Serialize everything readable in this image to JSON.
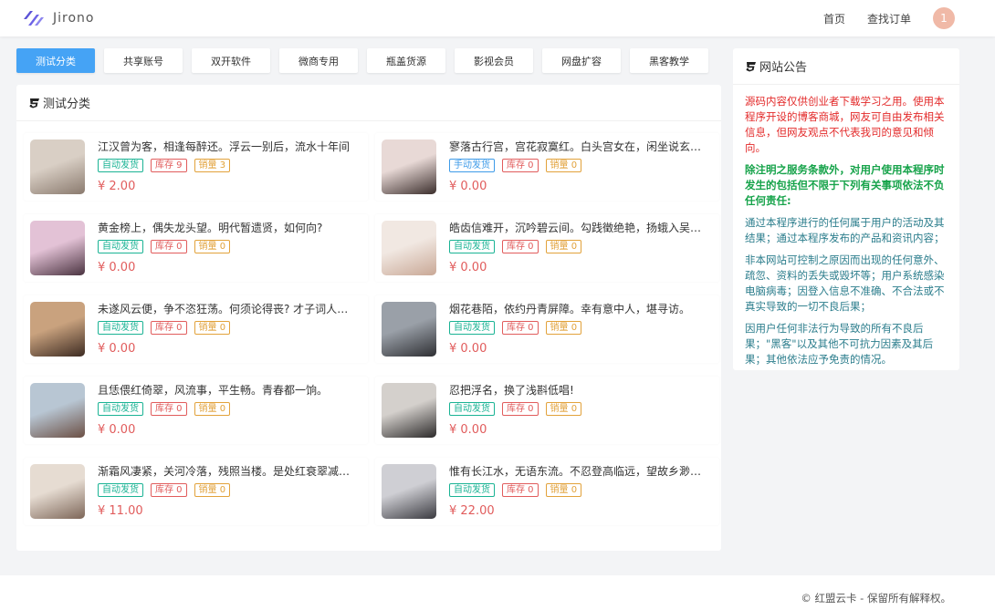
{
  "header": {
    "logo_text": "Jirono",
    "nav": [
      "首页",
      "查找订单"
    ],
    "avatar_text": "1"
  },
  "tabs": [
    "测试分类",
    "共享账号",
    "双开软件",
    "微商专用",
    "瓶盖货源",
    "影视会员",
    "网盘扩容",
    "黑客教学"
  ],
  "category_title": "测试分类",
  "products": [
    {
      "title": "江汉曾为客，相逢每醉还。浮云一别后，流水十年间",
      "delivery": "自动发货",
      "delivery_type": "auto",
      "stock": "库存 9",
      "sales": "销量 3",
      "price": "¥ 2.00",
      "thumb": [
        "#d9cfc5",
        "#8a7a6e"
      ]
    },
    {
      "title": "寥落古行宫，宫花寂寞红。白头宫女在，闲坐说玄宗。",
      "delivery": "手动发货",
      "delivery_type": "manual",
      "stock": "库存 0",
      "sales": "销量 0",
      "price": "¥ 0.00",
      "thumb": [
        "#e8d9d6",
        "#3b2e2c"
      ]
    },
    {
      "title": "黄金榜上，偶失龙头望。明代暂遗贤，如何向?",
      "delivery": "自动发货",
      "delivery_type": "auto",
      "stock": "库存 0",
      "sales": "销量 0",
      "price": "¥ 0.00",
      "thumb": [
        "#e3c2d6",
        "#4a3340"
      ]
    },
    {
      "title": "皓齿信难开，沉吟碧云间。勾践徵绝艳，扬蛾入吴关。",
      "delivery": "自动发货",
      "delivery_type": "auto",
      "stock": "库存 0",
      "sales": "销量 0",
      "price": "¥ 0.00",
      "thumb": [
        "#f1e8e2",
        "#c9a896"
      ]
    },
    {
      "title": "未遂风云便，争不恣狂荡。何须论得丧? 才子词人，自是白衣卿相。",
      "delivery": "自动发货",
      "delivery_type": "auto",
      "stock": "库存 0",
      "sales": "销量 0",
      "price": "¥ 0.00",
      "thumb": [
        "#c9a27e",
        "#3d2b22"
      ]
    },
    {
      "title": "烟花巷陌，依约丹青屏障。幸有意中人，堪寻访。",
      "delivery": "自动发货",
      "delivery_type": "auto",
      "stock": "库存 0",
      "sales": "销量 0",
      "price": "¥ 0.00",
      "thumb": [
        "#9aa0a8",
        "#2e2f33"
      ]
    },
    {
      "title": "且恁偎红倚翠，风流事，平生畅。青春都一饷。",
      "delivery": "自动发货",
      "delivery_type": "auto",
      "stock": "库存 0",
      "sales": "销量 0",
      "price": "¥ 0.00",
      "thumb": [
        "#b8c6d3",
        "#6b4f44"
      ]
    },
    {
      "title": "忍把浮名，换了浅斟低唱!",
      "delivery": "自动发货",
      "delivery_type": "auto",
      "stock": "库存 0",
      "sales": "销量 0",
      "price": "¥ 0.00",
      "thumb": [
        "#d4d0cc",
        "#2c2a2a"
      ]
    },
    {
      "title": "渐霜风凄紧，关河冷落，残照当楼。是处红衰翠减，苒苒物华休。",
      "delivery": "自动发货",
      "delivery_type": "auto",
      "stock": "库存 0",
      "sales": "销量 0",
      "price": "¥ 11.00",
      "thumb": [
        "#e6dcd2",
        "#7d6658"
      ]
    },
    {
      "title": "惟有长江水，无语东流。不忍登高临远，望故乡渺邈，归思难收。",
      "delivery": "自动发货",
      "delivery_type": "auto",
      "stock": "库存 0",
      "sales": "销量 0",
      "price": "¥ 22.00",
      "thumb": [
        "#cfcfd4",
        "#3a3a40"
      ]
    }
  ],
  "announcement": {
    "title": "网站公告",
    "p1": "源码内容仅供创业者下载学习之用。使用本程序开设的博客商城，网友可自由发布相关信息，但网友观点不代表我司的意见和倾向。",
    "p2": "除注明之服务条款外，对用户使用本程序时发生的包括但不限于下列有关事项依法不负任何责任:",
    "p3": "通过本程序进行的任何属于用户的活动及其结果；通过本程序发布的产品和资讯内容；",
    "p4": "非本网站可控制之原因而出现的任何意外、疏忽、资料的丢失或毁坏等；用户系统感染电脑病毒；因登入信息不准确、不合法或不真实导致的一切不良后果；",
    "p5": "因用户任何非法行为导致的所有不良后果；\"黑客\"以及其他不可抗力因素及其后果；其他依法应予免责的情况。"
  },
  "footer": {
    "copyright": "© 红盟云卡 - 保留所有解释权。"
  },
  "colors": {
    "primary": "#45a3f5",
    "price": "#e15c5c",
    "auto_badge": "#1ab394",
    "manual_badge": "#3e9be8",
    "stock_badge": "#e15c5c",
    "sales_badge": "#e2a23b"
  }
}
